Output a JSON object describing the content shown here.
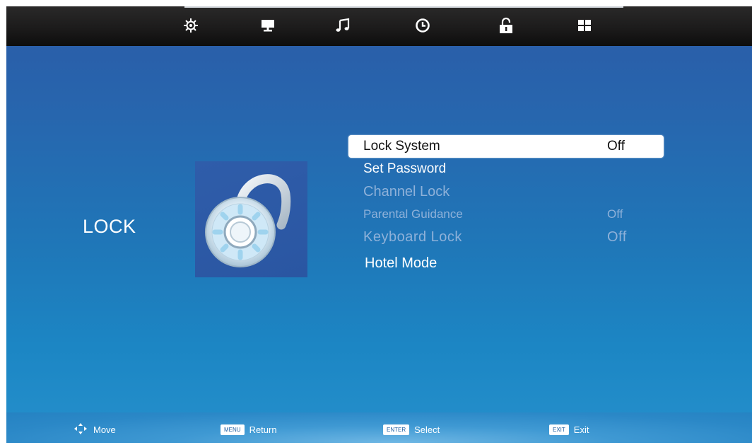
{
  "top_nav": {
    "icons": [
      "picture-settings-icon",
      "screen-icon",
      "music-note-icon",
      "clock-icon",
      "padlock-icon",
      "grid-icon"
    ]
  },
  "page": {
    "title": "LOCK",
    "image": "combination-padlock-icon"
  },
  "menu": {
    "items": [
      {
        "label": "Lock System",
        "value": "Off",
        "state": "selected"
      },
      {
        "label": "Set Password",
        "value": "",
        "state": "enabled"
      },
      {
        "label": "Channel Lock",
        "value": "",
        "state": "disabled"
      },
      {
        "label": "Parental Guidance",
        "value": "Off",
        "state": "disabled"
      },
      {
        "label": "Keyboard Lock",
        "value": "Off",
        "state": "disabled"
      },
      {
        "label": "Hotel Mode",
        "value": "",
        "state": "enabled"
      }
    ]
  },
  "footer": {
    "hints": [
      {
        "key": "",
        "icon": "move-arrows-icon",
        "text": "Move"
      },
      {
        "key": "MENU",
        "text": "Return"
      },
      {
        "key": "ENTER",
        "text": "Select"
      },
      {
        "key": "EXIT",
        "text": "Exit"
      }
    ]
  },
  "colors": {
    "background_top": "#2b5ba7",
    "background_bottom": "#2590cc",
    "top_bar": "#1c1b1b",
    "highlight": "#ffffff",
    "disabled_text": "#8eb1d9"
  }
}
